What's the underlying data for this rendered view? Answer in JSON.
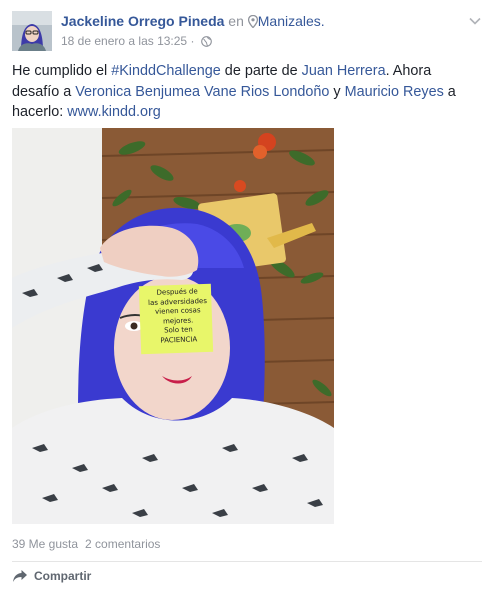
{
  "post": {
    "author": "Jackeline Orrego Pineda",
    "in_word": "en",
    "location": "Manizales.",
    "timestamp": "18 de enero a las 13:25",
    "dot": "·",
    "icons": {
      "avatar": "profile-photo",
      "location": "location-pin-icon",
      "privacy": "globe-icon",
      "options": "chevron-down-icon",
      "share": "share-arrow-icon"
    },
    "text": {
      "p1": "He cumplido el ",
      "hashtag": "#KinddChallenge",
      "p2": " de parte de ",
      "mention1": "Juan Herrera",
      "p3": ". Ahora desafío a ",
      "mention2": "Veronica Benjumea",
      "p4": " ",
      "mention3": "Vane Rios Londoño",
      "p5": " y ",
      "mention4": "Mauricio Reyes",
      "p6": " a hacerlo: ",
      "link": "www.kindd.org"
    },
    "photo": {
      "note_lines": [
        "Después de",
        "las adversidades",
        "vienen cosas",
        "mejores.",
        "Solo ten",
        "PACIENCIA"
      ]
    },
    "stats": {
      "likes": "39 Me gusta",
      "comments": "2 comentarios"
    },
    "actions": {
      "share_label": "Compartir"
    },
    "colors": {
      "link": "#365899",
      "meta": "#90949c",
      "text": "#1d2129",
      "note": "#e8f66a",
      "hair": "#3a3ad0"
    }
  }
}
